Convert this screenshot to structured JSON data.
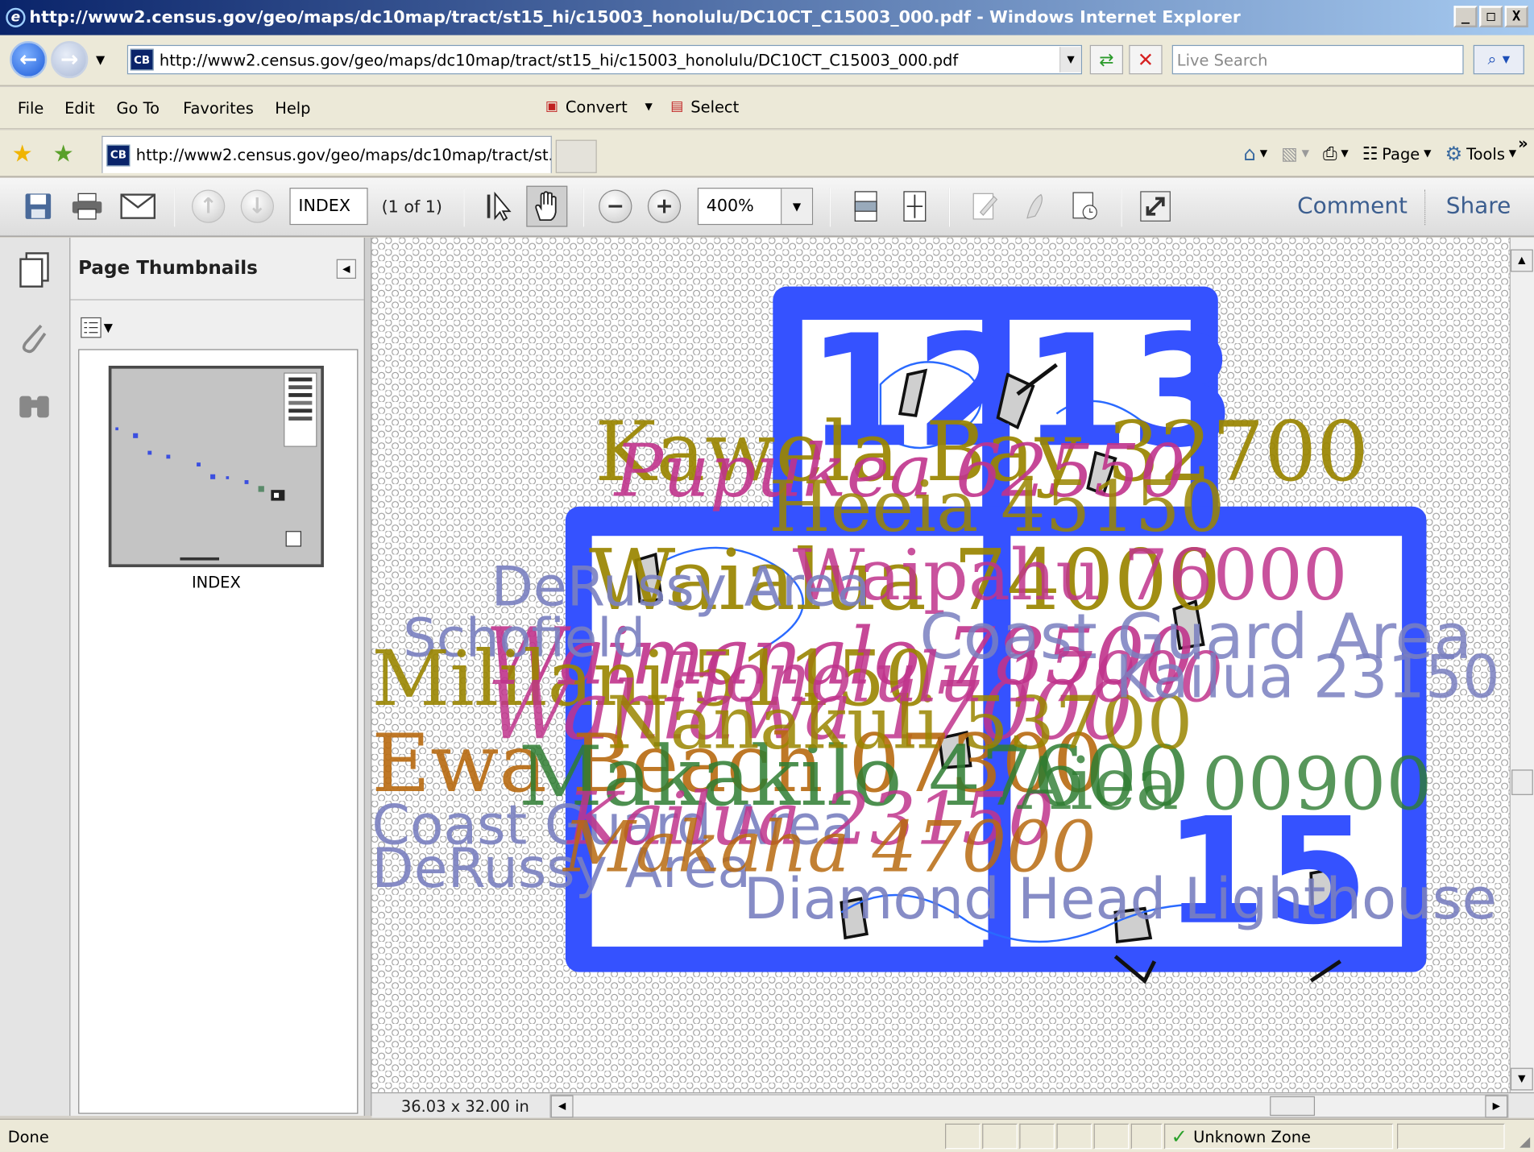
{
  "window": {
    "title": "http://www2.census.gov/geo/maps/dc10map/tract/st15_hi/c15003_honolulu/DC10CT_C15003_000.pdf - Windows Internet Explorer",
    "controls": [
      "_",
      "□",
      "X"
    ]
  },
  "address": {
    "url": "http://www2.census.gov/geo/maps/dc10map/tract/st15_hi/c15003_honolulu/DC10CT_C15003_000.pdf",
    "site_icon": "CB",
    "search_placeholder": "Live Search"
  },
  "menu": {
    "items": [
      "File",
      "Edit",
      "Go To",
      "Favorites",
      "Help"
    ],
    "convert_label": "Convert",
    "select_label": "Select"
  },
  "favorites": {
    "tab_title": "http://www2.census.gov/geo/maps/dc10map/tract/st...",
    "page_label": "Page",
    "tools_label": "Tools",
    "more": "»"
  },
  "pdf_toolbar": {
    "page_value": "INDEX",
    "page_count": "(1 of 1)",
    "zoom_value": "400%",
    "comment_label": "Comment",
    "share_label": "Share"
  },
  "nav_panel": {
    "title": "Page Thumbnails",
    "thumbnail_label": "INDEX"
  },
  "map": {
    "big_numbers": [
      "1213",
      "15"
    ],
    "labels": [
      {
        "text": "Kawela Bay 32700",
        "color": "#9a8500"
      },
      {
        "text": "Pupukea 62550",
        "color": "#c0348c"
      },
      {
        "text": "Heeia 45150",
        "color": "#9a8500"
      },
      {
        "text": "Waialua 74000",
        "color": "#9a8500"
      },
      {
        "text": "Waipahu 76000",
        "color": "#c0348c"
      },
      {
        "text": "Waimanalo 78500",
        "color": "#c0348c"
      },
      {
        "text": "Mililani 51150",
        "color": "#9a8500"
      },
      {
        "text": "Makakilo 47600",
        "color": "#2e7d32"
      },
      {
        "text": "Honolulu 17000",
        "color": "#c0348c"
      },
      {
        "text": "Nanakuli 53700",
        "color": "#9a8500"
      },
      {
        "text": "Kailua 23150",
        "color": "#7a80c0"
      },
      {
        "text": "Aiea 00900",
        "color": "#9a8500"
      },
      {
        "text": "Ewa Beach 07300",
        "color": "#b86a10"
      },
      {
        "text": "Coast Guard Area",
        "color": "#7a80c0"
      },
      {
        "text": "DeRussy Area",
        "color": "#7a80c0"
      },
      {
        "text": "Diamond Head Lighthouse",
        "color": "#7a80c0"
      },
      {
        "text": "Schofield",
        "color": "#7a80c0"
      },
      {
        "text": "Wahiawa",
        "color": "#c0348c"
      },
      {
        "text": "Makaha 47000",
        "color": "#b86a10"
      }
    ]
  },
  "footer": {
    "page_size": "36.03 x 32.00 in"
  },
  "status": {
    "text": "Done",
    "zone": "Unknown Zone"
  }
}
